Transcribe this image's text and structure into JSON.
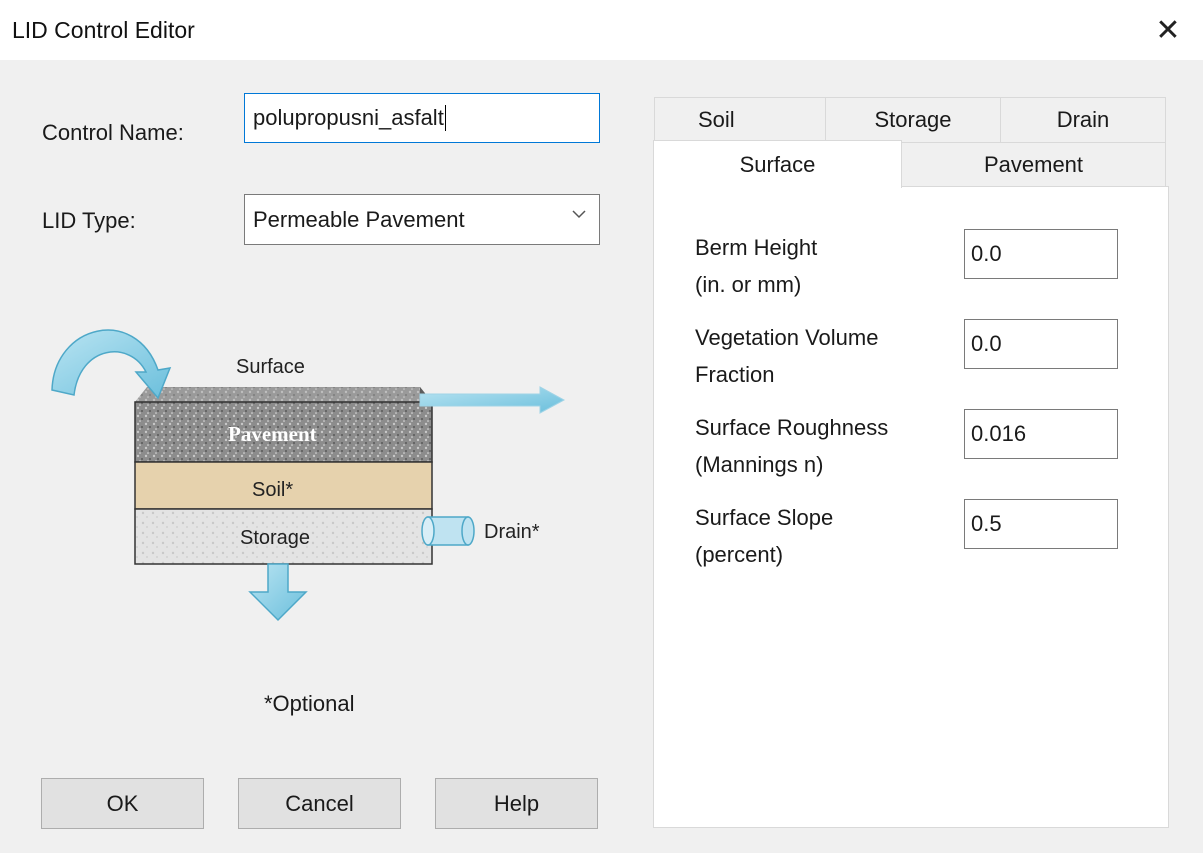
{
  "window": {
    "title": "LID Control Editor"
  },
  "form": {
    "control_name_label": "Control Name:",
    "control_name_value": "polupropusni_asfalt",
    "lid_type_label": "LID Type:",
    "lid_type_value": "Permeable Pavement"
  },
  "diagram": {
    "surface": "Surface",
    "pavement": "Pavement",
    "soil": "Soil*",
    "storage": "Storage",
    "drain": "Drain*",
    "optional_note": "*Optional"
  },
  "buttons": {
    "ok": "OK",
    "cancel": "Cancel",
    "help": "Help"
  },
  "tabs": {
    "back_row": [
      "Soil",
      "Storage",
      "Drain"
    ],
    "front_row": [
      "Surface",
      "Pavement"
    ],
    "active": "Surface"
  },
  "surface_fields": [
    {
      "label_line1": "Berm Height",
      "label_line2": "(in. or mm)",
      "value": "0.0"
    },
    {
      "label_line1": "Vegetation Volume",
      "label_line2": "Fraction",
      "value": "0.0"
    },
    {
      "label_line1": "Surface Roughness",
      "label_line2": "(Mannings n)",
      "value": "0.016"
    },
    {
      "label_line1": "Surface Slope",
      "label_line2": "(percent)",
      "value": "0.5"
    }
  ],
  "icons": [
    "close-icon",
    "chevron-down-icon",
    "runoff-arrow-icon",
    "outflow-arrow-icon",
    "infiltration-arrow-icon",
    "drain-pipe-icon"
  ],
  "colors": {
    "focus_border": "#0078d7",
    "arrow_blue": "#7ec8e3",
    "soil": "#e6d2ad"
  }
}
